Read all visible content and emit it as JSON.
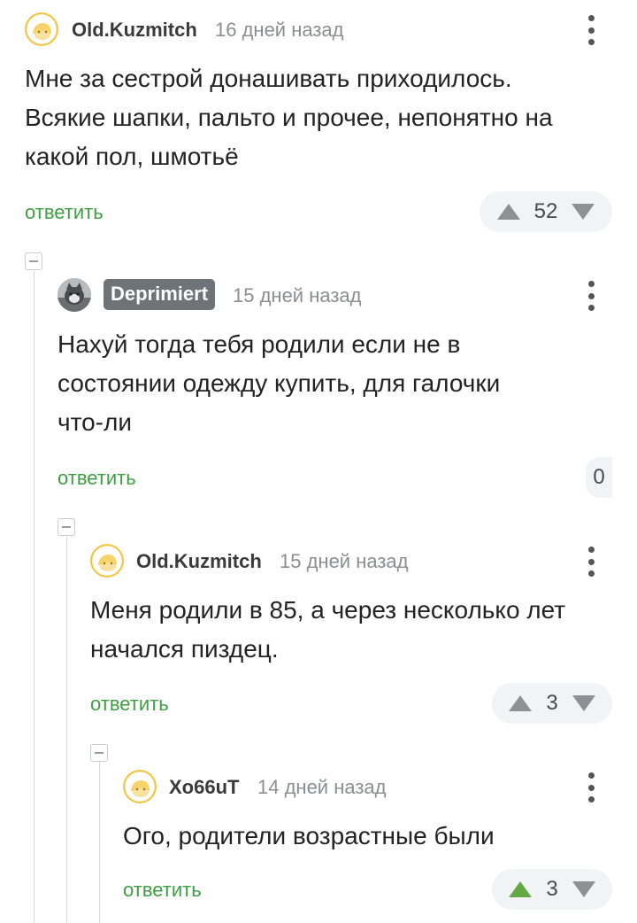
{
  "comments": [
    {
      "author": "Old.Kuzmitch",
      "time": "16 дней назад",
      "text_lines": [
        "Мне за сестрой донашивать приходилось.",
        "Всякие шапки, пальто и прочее, непонятно на",
        "какой пол, шмотьё"
      ],
      "reply_label": "ответить",
      "rating": "52"
    },
    {
      "author": "Deprimiert",
      "time": "15 дней назад",
      "text_lines": [
        "Нахуй тогда тебя родили если не в",
        "состоянии одежду купить, для галочки",
        "что-ли"
      ],
      "reply_label": "ответить",
      "rating": "0"
    },
    {
      "author": "Old.Kuzmitch",
      "time": "15 дней назад",
      "text_lines": [
        "Меня родили в 85, а через несколько лет",
        "начался пиздец."
      ],
      "reply_label": "ответить",
      "rating": "3"
    },
    {
      "author": "Xo66uT",
      "time": "14 дней назад",
      "text_lines": [
        "Ого, родители возрастные были"
      ],
      "reply_label": "ответить",
      "rating": "3"
    }
  ],
  "colors": {
    "reply_green": "#3d9f42",
    "upvote_active": "#62a944",
    "rating_bg": "#f2f3f5"
  },
  "icons": {
    "avatar_default": "smiley-face-avatar",
    "avatar_photo": "grey-cat-photo-avatar",
    "menu": "vertical-dots-icon",
    "collapse": "collapse-minus-icon"
  }
}
